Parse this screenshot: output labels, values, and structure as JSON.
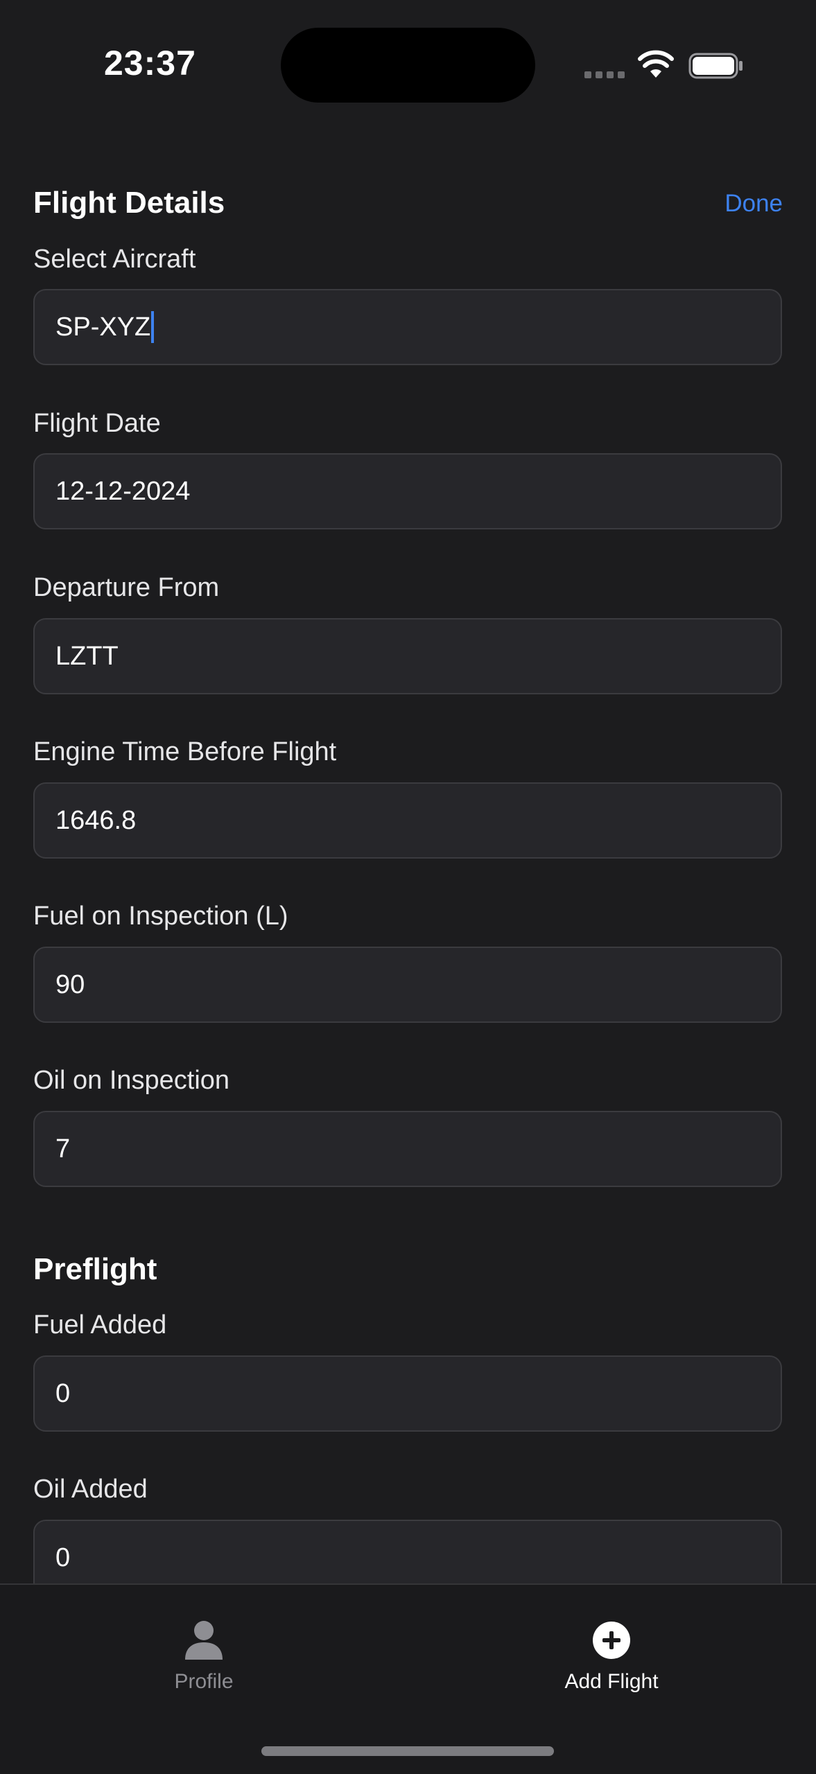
{
  "status_bar": {
    "time": "23:37"
  },
  "form": {
    "section_title": "Flight Details",
    "done_label": "Done",
    "accent_color": "#3d82f0",
    "fields": [
      {
        "label": "Select Aircraft",
        "value": "SP-XYZ"
      },
      {
        "label": "Flight Date",
        "value": "12-12-2024"
      },
      {
        "label": "Departure From",
        "value": "LZTT"
      },
      {
        "label": "Engine Time Before Flight",
        "value": "1646.8"
      },
      {
        "label": "Fuel on Inspection (L)",
        "value": "90"
      },
      {
        "label": "Oil on Inspection",
        "value": "7"
      }
    ],
    "preflight_title": "Preflight",
    "preflight_fields": [
      {
        "label": "Fuel Added",
        "value": "0"
      },
      {
        "label": "Oil Added",
        "value": "0"
      }
    ]
  },
  "tab_bar": {
    "tabs": [
      {
        "label": "Profile",
        "icon": "person-icon",
        "selected": false
      },
      {
        "label": "Add Flight",
        "icon": "plus-circle-icon",
        "selected": true
      }
    ]
  }
}
